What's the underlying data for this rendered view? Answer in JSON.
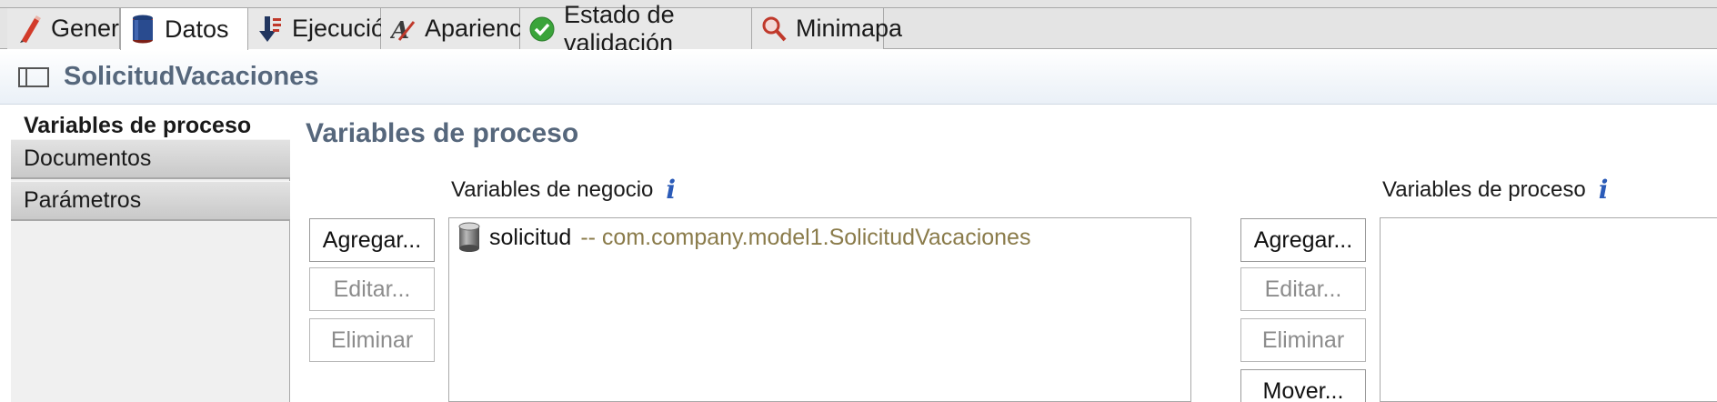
{
  "tabs": [
    {
      "label": "General",
      "icon": "pencil-icon",
      "active": false
    },
    {
      "label": "Datos",
      "icon": "database-icon",
      "active": true
    },
    {
      "label": "Ejecución",
      "icon": "execution-icon",
      "active": false
    },
    {
      "label": "Apariencia",
      "icon": "appearance-icon",
      "active": false
    },
    {
      "label": "Estado de validación",
      "icon": "check-icon",
      "active": false
    },
    {
      "label": "Minimapa",
      "icon": "magnifier-icon",
      "active": false
    }
  ],
  "editor": {
    "title": "SolicitudVacaciones"
  },
  "leftnav": {
    "items": [
      {
        "label": "Variables de proceso",
        "selected": true
      },
      {
        "label": "Documentos",
        "selected": false
      },
      {
        "label": "Parámetros",
        "selected": false
      }
    ]
  },
  "main": {
    "section_title": "Variables de proceso",
    "business": {
      "label": "Variables de negocio",
      "buttons": {
        "add": "Agregar...",
        "edit": "Editar...",
        "delete": "Eliminar"
      },
      "items": [
        {
          "name": "solicitud",
          "type": "-- com.company.model1.SolicitudVacaciones"
        }
      ]
    },
    "process": {
      "label": "Variables de proceso",
      "buttons": {
        "add": "Agregar...",
        "edit": "Editar...",
        "delete": "Eliminar",
        "move": "Mover..."
      },
      "items": []
    }
  },
  "colors": {
    "title_text": "#56677c",
    "info_icon": "#2b5bb8",
    "type_text": "#8a7b4a"
  }
}
